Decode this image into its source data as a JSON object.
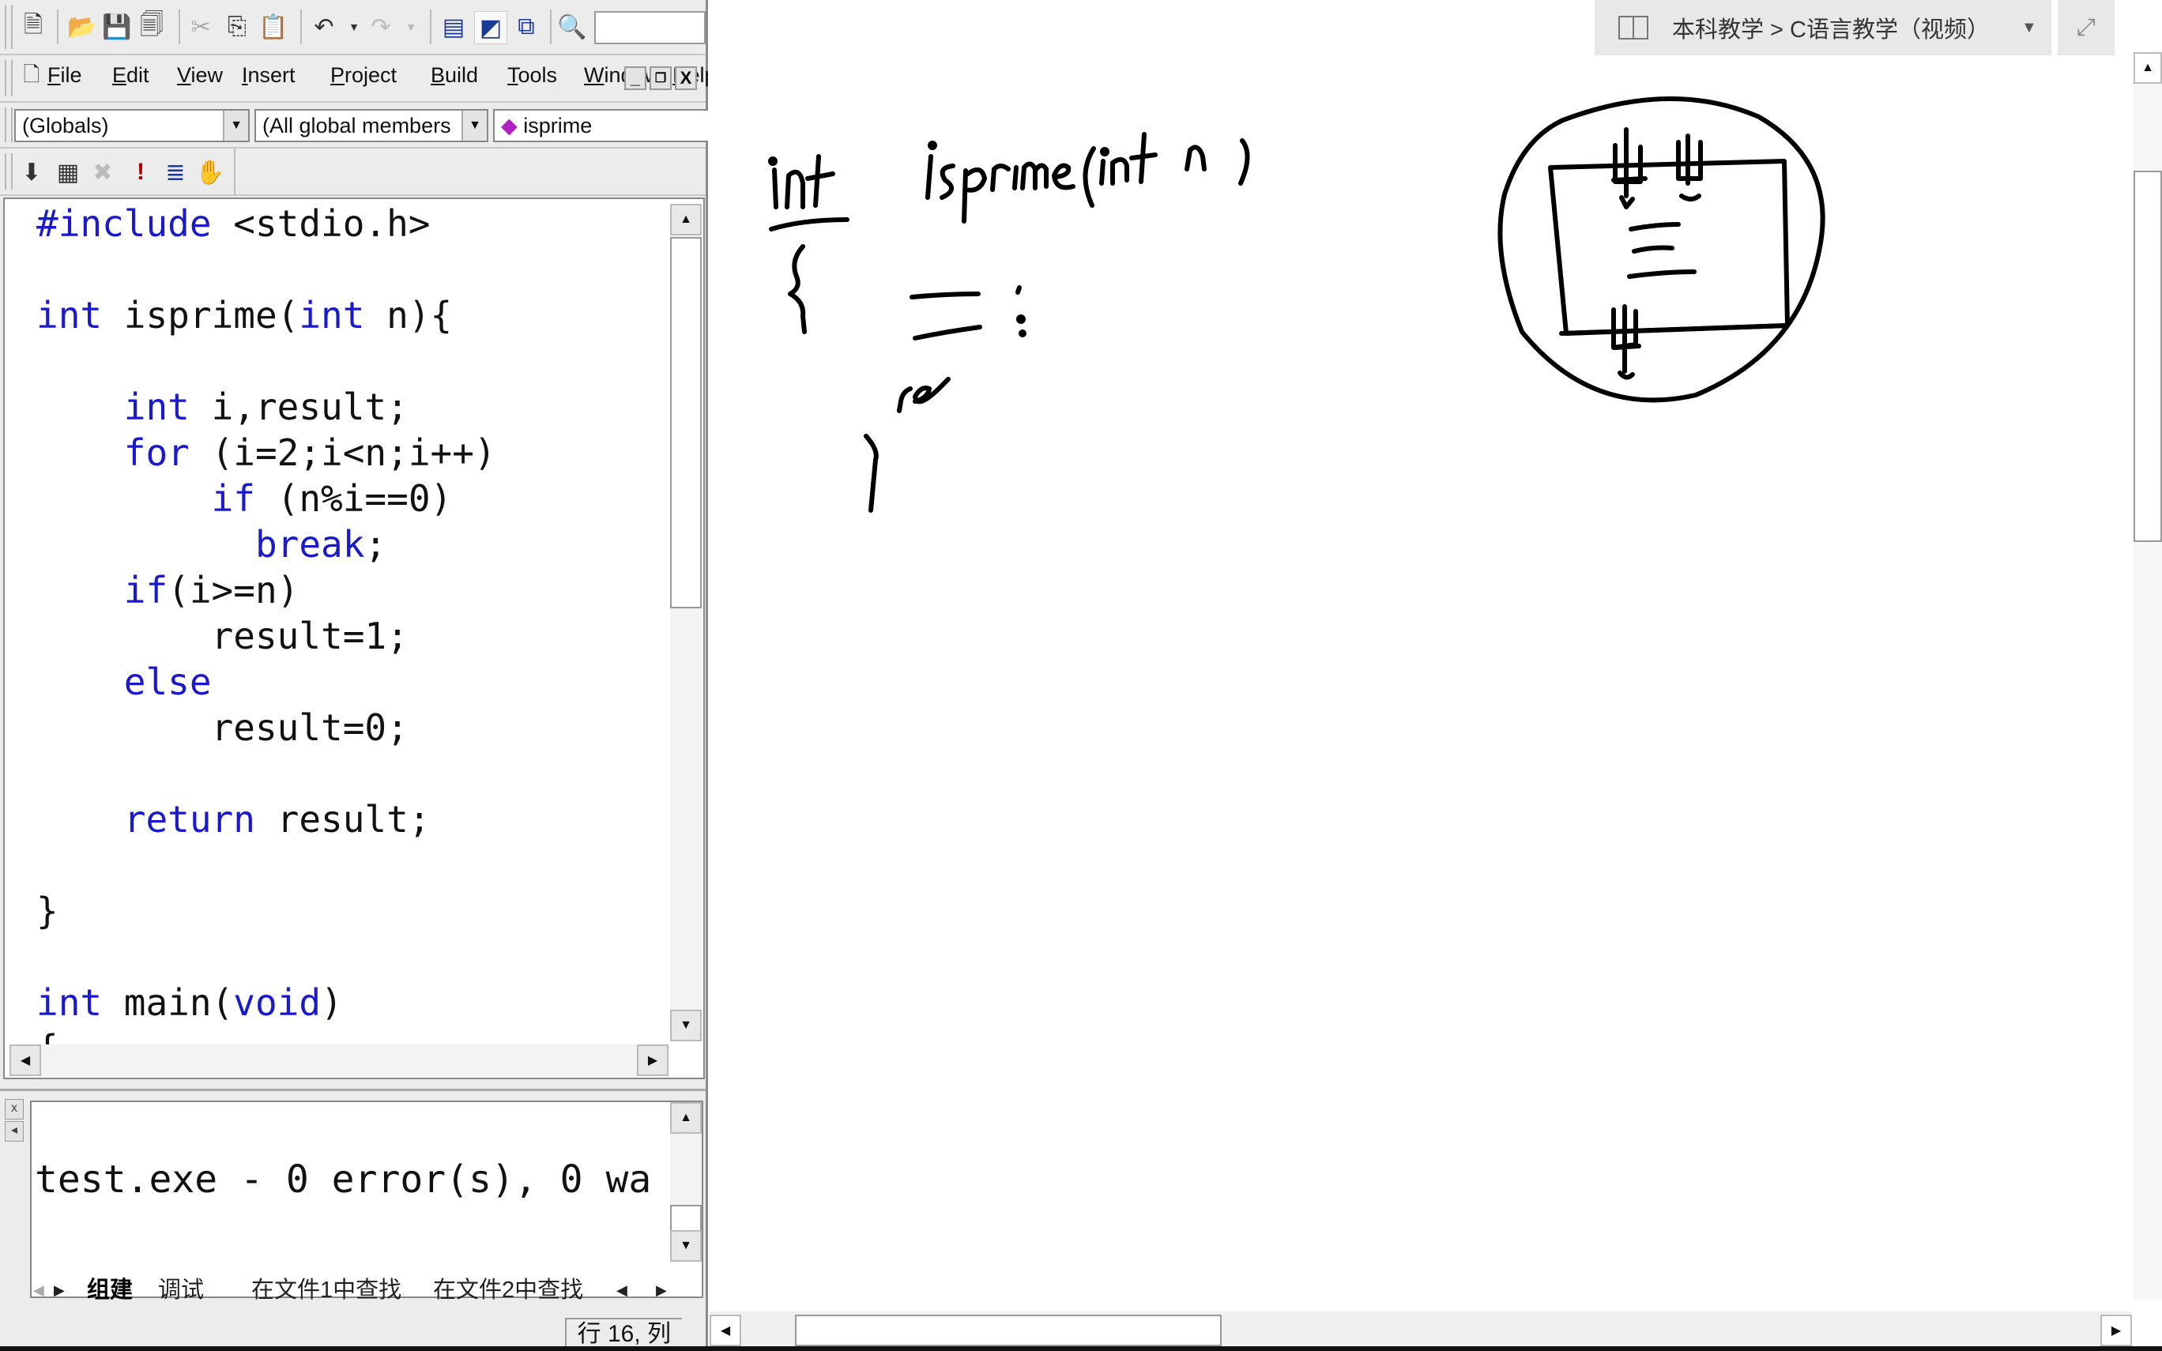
{
  "ide": {
    "toolbar1": {
      "icons": [
        "new-file-icon",
        "open-folder-icon",
        "save-icon",
        "save-all-icon",
        "cut-icon",
        "copy-icon",
        "paste-icon",
        "undo-icon",
        "redo-icon",
        "workspace-icon",
        "output-icon",
        "window-list-icon",
        "find-in-files-icon"
      ],
      "find_value": ""
    },
    "menu": {
      "items": [
        {
          "label": "File",
          "accel": "F"
        },
        {
          "label": "Edit",
          "accel": "E"
        },
        {
          "label": "View",
          "accel": "V"
        },
        {
          "label": "Insert",
          "accel": "I"
        },
        {
          "label": "Project",
          "accel": "P"
        },
        {
          "label": "Build",
          "accel": "B"
        },
        {
          "label": "Tools",
          "accel": "T"
        },
        {
          "label": "Window",
          "accel": "W"
        },
        {
          "label": "Help",
          "accel": "H"
        }
      ],
      "mdi_buttons": [
        "_",
        "❐",
        "X"
      ]
    },
    "wizardbar": {
      "scope": "(Globals)",
      "members": "(All global members",
      "function": "isprime"
    },
    "build_toolbar": {
      "icons": [
        "compile-icon",
        "build-icon",
        "stop-build-icon",
        "execute-icon",
        "go-icon",
        "breakpoint-hand-icon"
      ]
    },
    "editor": {
      "lines": [
        [
          {
            "t": "#include",
            "kw": true
          },
          {
            "t": " <stdio.h>",
            "kw": false
          }
        ],
        [],
        [
          {
            "t": "int",
            "kw": true
          },
          {
            "t": " isprime(",
            "kw": false
          },
          {
            "t": "int",
            "kw": true
          },
          {
            "t": " n){",
            "kw": false
          }
        ],
        [],
        [
          {
            "t": "    ",
            "kw": false
          },
          {
            "t": "int",
            "kw": true
          },
          {
            "t": " i,result;",
            "kw": false
          }
        ],
        [
          {
            "t": "    ",
            "kw": false
          },
          {
            "t": "for",
            "kw": true
          },
          {
            "t": " (i=2;i<n;i++)",
            "kw": false
          }
        ],
        [
          {
            "t": "        ",
            "kw": false
          },
          {
            "t": "if",
            "kw": true
          },
          {
            "t": " (n%i==0)",
            "kw": false
          }
        ],
        [
          {
            "t": "          ",
            "kw": false
          },
          {
            "t": "break",
            "kw": true
          },
          {
            "t": ";",
            "kw": false
          }
        ],
        [
          {
            "t": "    ",
            "kw": false
          },
          {
            "t": "if",
            "kw": true
          },
          {
            "t": "(i>=n)",
            "kw": false
          }
        ],
        [
          {
            "t": "        result=1;",
            "kw": false
          }
        ],
        [
          {
            "t": "    ",
            "kw": false
          },
          {
            "t": "else",
            "kw": true
          }
        ],
        [
          {
            "t": "        result=0;",
            "kw": false
          }
        ],
        [],
        [
          {
            "t": "    ",
            "kw": false
          },
          {
            "t": "return",
            "kw": true
          },
          {
            "t": " result;",
            "kw": false
          }
        ],
        [],
        [
          {
            "t": "}",
            "kw": false
          }
        ],
        [],
        [
          {
            "t": "int",
            "kw": true
          },
          {
            "t": " main(",
            "kw": false
          },
          {
            "t": "void",
            "kw": true
          },
          {
            "t": ")",
            "kw": false
          }
        ],
        [
          {
            "t": "{",
            "kw": false
          }
        ]
      ]
    },
    "output": {
      "text": "test.exe - 0 error(s), 0 wa",
      "tabs": [
        "组建",
        "调试",
        "在文件1中查找",
        "在文件2中查找"
      ],
      "active_tab": "组建"
    },
    "status": {
      "position": "行 16, 列"
    }
  },
  "board": {
    "breadcrumb": "本科教学 > C语言教学（视频）",
    "handwriting": {
      "line1_keyword": "int",
      "line1_signature": "isprime(int n)",
      "open_brace": "{",
      "body_placeholder": "= :",
      "close_brace": "}",
      "partial_word": "re"
    }
  },
  "colors": {
    "keyword": "#1a1acc",
    "ink": "#000000",
    "chrome": "#ececec"
  }
}
